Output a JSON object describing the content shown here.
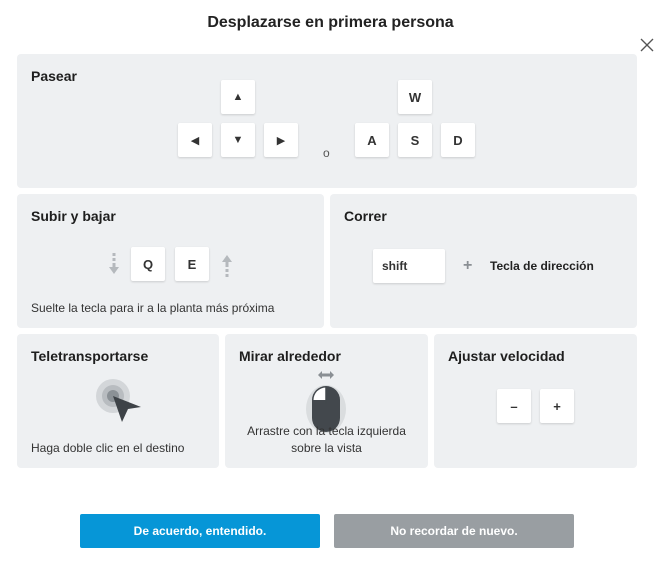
{
  "dialog": {
    "title": "Desplazarse en primera persona"
  },
  "walk": {
    "title": "Pasear",
    "arrow_up": "▲",
    "arrow_left": "◀",
    "arrow_down": "▼",
    "arrow_right": "▶",
    "or_text": "o",
    "key_w": "W",
    "key_a": "A",
    "key_s": "S",
    "key_d": "D"
  },
  "updown": {
    "title": "Subir y bajar",
    "key_q": "Q",
    "key_e": "E",
    "hint": "Suelte la tecla para ir a la planta más próxima"
  },
  "run": {
    "title": "Correr",
    "key_shift": "shift",
    "plus": "+",
    "direction_label": "Tecla de dirección"
  },
  "teleport": {
    "title": "Teletransportarse",
    "hint": "Haga doble clic en el destino"
  },
  "look": {
    "title": "Mirar alrededor",
    "hint_line1": "Arrastre con la tecla izquierda",
    "hint_line2": "sobre la vista"
  },
  "speed": {
    "title": "Ajustar velocidad",
    "minus": "–",
    "plus": "+"
  },
  "buttons": {
    "ok_label": "De acuerdo, entendido.",
    "dont_remind_label": "No recordar de nuevo."
  },
  "colors": {
    "panel_bg": "#eef0f2",
    "primary_button": "#0696d7",
    "secondary_button": "#999ea2"
  },
  "icons": {
    "close": "close-icon",
    "down_arrow": "arrow-down-dashed-icon",
    "up_arrow": "arrow-up-dashed-icon",
    "teleport": "cursor-target-icon",
    "mouse": "mouse-left-button-icon",
    "horizontal_drag": "horizontal-arrows-icon"
  }
}
